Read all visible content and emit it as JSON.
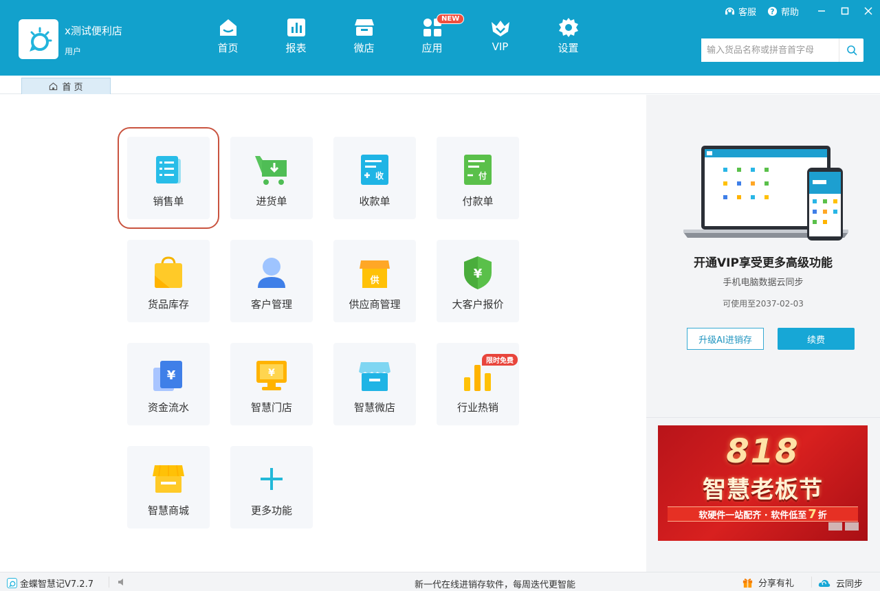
{
  "header": {
    "store_name": "x测试便利店",
    "store_user": "用户",
    "nav": [
      {
        "label": "首页",
        "icon": "home-icon"
      },
      {
        "label": "报表",
        "icon": "report-icon"
      },
      {
        "label": "微店",
        "icon": "shop-icon"
      },
      {
        "label": "应用",
        "icon": "apps-icon",
        "badge": "NEW"
      },
      {
        "label": "VIP",
        "icon": "vip-crown-icon"
      },
      {
        "label": "设置",
        "icon": "gear-icon"
      }
    ],
    "links": {
      "service": "客服",
      "help": "帮助"
    },
    "search": {
      "placeholder": "输入货品名称或拼音首字母",
      "value": ""
    }
  },
  "tabs": [
    {
      "label": "首 页",
      "icon": "home-outline-icon",
      "active": true
    }
  ],
  "grid": {
    "tiles": [
      {
        "label": "销售单",
        "icon": "sales-order-icon",
        "selected": true
      },
      {
        "label": "进货单",
        "icon": "purchase-cart-icon"
      },
      {
        "label": "收款单",
        "icon": "receipt-icon"
      },
      {
        "label": "付款单",
        "icon": "payment-icon"
      },
      {
        "label": "货品库存",
        "icon": "inventory-bag-icon"
      },
      {
        "label": "客户管理",
        "icon": "customer-icon"
      },
      {
        "label": "供应商管理",
        "icon": "supplier-icon"
      },
      {
        "label": "大客户报价",
        "icon": "shield-yen-icon"
      },
      {
        "label": "资金流水",
        "icon": "cash-flow-icon"
      },
      {
        "label": "智慧门店",
        "icon": "smart-store-icon"
      },
      {
        "label": "智慧微店",
        "icon": "smart-microshop-icon"
      },
      {
        "label": "行业热销",
        "icon": "bar-chart-icon",
        "badge": "限时免费"
      },
      {
        "label": "智慧商城",
        "icon": "smart-mall-icon"
      },
      {
        "label": "更多功能",
        "icon": "plus-icon"
      }
    ]
  },
  "vip": {
    "title": "开通VIP享受更多高级功能",
    "subtitle": "手机电脑数据云同步",
    "valid_until": "可使用至2037-02-03",
    "upgrade_label": "升级AI进销存",
    "renew_label": "续费"
  },
  "banner": {
    "number": "818",
    "title": "智慧老板节",
    "strip_text": "软硬件一站配齐 · 软件低至",
    "strip_big": "7",
    "strip_suffix": "折"
  },
  "status": {
    "app_version": "金蝶智慧记V7.2.7",
    "message": "新一代在线进销存软件，每周迭代更智能",
    "share_label": "分享有礼",
    "sync_label": "云同步"
  },
  "colors": {
    "header_bg": "#12a1cc",
    "accent": "#17a7d6",
    "selected_outline": "#c9533f",
    "badge_red": "#f04f3e"
  }
}
